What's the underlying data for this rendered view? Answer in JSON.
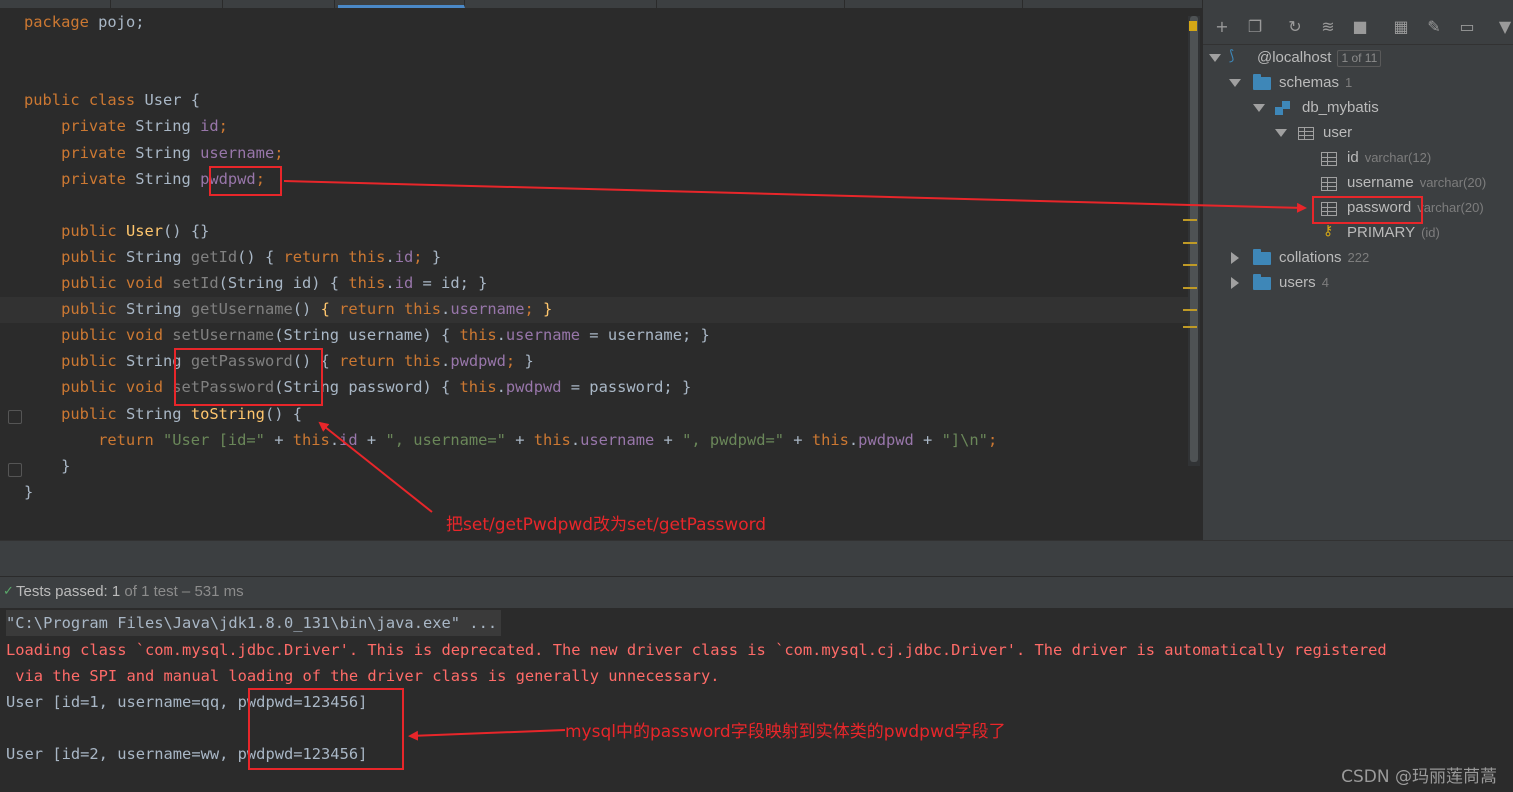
{
  "editor": {
    "lines": [
      {
        "parts": [
          {
            "t": "package ",
            "c": "kw"
          },
          {
            "t": "pojo;",
            "c": ""
          }
        ]
      },
      {
        "parts": []
      },
      {
        "parts": []
      },
      {
        "parts": [
          {
            "t": "public class ",
            "c": "kw"
          },
          {
            "t": "User {",
            "c": ""
          }
        ]
      },
      {
        "parts": [
          {
            "t": "    private ",
            "c": "kw"
          },
          {
            "t": "String ",
            "c": ""
          },
          {
            "t": "id",
            "c": "fld"
          },
          {
            "t": ";",
            "c": "kw"
          }
        ]
      },
      {
        "parts": [
          {
            "t": "    private ",
            "c": "kw"
          },
          {
            "t": "String ",
            "c": ""
          },
          {
            "t": "username",
            "c": "fld"
          },
          {
            "t": ";",
            "c": "kw"
          }
        ]
      },
      {
        "parts": [
          {
            "t": "    private ",
            "c": "kw"
          },
          {
            "t": "String ",
            "c": ""
          },
          {
            "t": "pwdpwd",
            "c": "fld"
          },
          {
            "t": ";",
            "c": "kw"
          }
        ]
      },
      {
        "parts": []
      },
      {
        "parts": [
          {
            "t": "    public ",
            "c": "kw"
          },
          {
            "t": "User",
            "c": "mth"
          },
          {
            "t": "() {}",
            "c": ""
          }
        ]
      },
      {
        "parts": [
          {
            "t": "    public ",
            "c": "kw"
          },
          {
            "t": "String ",
            "c": ""
          },
          {
            "t": "getId",
            "c": "dim"
          },
          {
            "t": "() { ",
            "c": ""
          },
          {
            "t": "return this",
            "c": "kw"
          },
          {
            "t": ".",
            "c": ""
          },
          {
            "t": "id",
            "c": "fld"
          },
          {
            "t": "; ",
            "c": "kw"
          },
          {
            "t": "}",
            "c": ""
          }
        ]
      },
      {
        "parts": [
          {
            "t": "    public void ",
            "c": "kw"
          },
          {
            "t": "setId",
            "c": "dim"
          },
          {
            "t": "(String id) { ",
            "c": ""
          },
          {
            "t": "this",
            "c": "kw"
          },
          {
            "t": ".",
            "c": ""
          },
          {
            "t": "id",
            "c": "fld"
          },
          {
            "t": " = id; }",
            "c": ""
          }
        ]
      },
      {
        "parts": [
          {
            "t": "    public ",
            "c": "kw"
          },
          {
            "t": "String ",
            "c": ""
          },
          {
            "t": "getUsername",
            "c": "dim"
          },
          {
            "t": "() ",
            "c": ""
          },
          {
            "t": "{",
            "c": "mth"
          },
          {
            "t": " return this",
            "c": "kw"
          },
          {
            "t": ".",
            "c": ""
          },
          {
            "t": "username",
            "c": "fld"
          },
          {
            "t": "; ",
            "c": "kw"
          },
          {
            "t": "}",
            "c": "mth"
          }
        ]
      },
      {
        "parts": [
          {
            "t": "    public void ",
            "c": "kw"
          },
          {
            "t": "setUsername",
            "c": "dim"
          },
          {
            "t": "(String username) { ",
            "c": ""
          },
          {
            "t": "this",
            "c": "kw"
          },
          {
            "t": ".",
            "c": ""
          },
          {
            "t": "username",
            "c": "fld"
          },
          {
            "t": " = username; }",
            "c": ""
          }
        ]
      },
      {
        "parts": [
          {
            "t": "    public ",
            "c": "kw"
          },
          {
            "t": "String ",
            "c": ""
          },
          {
            "t": "getPassword",
            "c": "dim"
          },
          {
            "t": "() { ",
            "c": ""
          },
          {
            "t": "return this",
            "c": "kw"
          },
          {
            "t": ".",
            "c": ""
          },
          {
            "t": "pwdpwd",
            "c": "fld"
          },
          {
            "t": "; ",
            "c": "kw"
          },
          {
            "t": "}",
            "c": ""
          }
        ]
      },
      {
        "parts": [
          {
            "t": "    public void ",
            "c": "kw"
          },
          {
            "t": "setPassword",
            "c": "dim"
          },
          {
            "t": "(String password) { ",
            "c": ""
          },
          {
            "t": "this",
            "c": "kw"
          },
          {
            "t": ".",
            "c": ""
          },
          {
            "t": "pwdpwd",
            "c": "fld"
          },
          {
            "t": " = password; }",
            "c": ""
          }
        ]
      },
      {
        "parts": [
          {
            "t": "    public ",
            "c": "kw"
          },
          {
            "t": "String ",
            "c": ""
          },
          {
            "t": "toString",
            "c": "mth"
          },
          {
            "t": "() {",
            "c": ""
          }
        ]
      },
      {
        "parts": [
          {
            "t": "        return ",
            "c": "kw"
          },
          {
            "t": "\"User [id=\"",
            "c": "str"
          },
          {
            "t": " + ",
            "c": ""
          },
          {
            "t": "this",
            "c": "kw"
          },
          {
            "t": ".",
            "c": ""
          },
          {
            "t": "id",
            "c": "fld"
          },
          {
            "t": " + ",
            "c": ""
          },
          {
            "t": "\", username=\"",
            "c": "str"
          },
          {
            "t": " + ",
            "c": ""
          },
          {
            "t": "this",
            "c": "kw"
          },
          {
            "t": ".",
            "c": ""
          },
          {
            "t": "username",
            "c": "fld"
          },
          {
            "t": " + ",
            "c": ""
          },
          {
            "t": "\", pwdpwd=\"",
            "c": "str"
          },
          {
            "t": " + ",
            "c": ""
          },
          {
            "t": "this",
            "c": "kw"
          },
          {
            "t": ".",
            "c": ""
          },
          {
            "t": "pwdpwd",
            "c": "fld"
          },
          {
            "t": " + ",
            "c": ""
          },
          {
            "t": "\"]\\n\"",
            "c": "str"
          },
          {
            "t": ";",
            "c": "kw"
          }
        ]
      },
      {
        "parts": [
          {
            "t": "    }",
            "c": ""
          }
        ]
      },
      {
        "parts": [
          {
            "t": "}",
            "c": ""
          }
        ]
      }
    ]
  },
  "db": {
    "host": "@localhost",
    "host_badge": "1 of 11",
    "schemas": "schemas",
    "schemas_count": "1",
    "db_name": "db_mybatis",
    "table": "user",
    "col_id": "id",
    "col_id_type": "varchar(12)",
    "col_username": "username",
    "col_username_type": "varchar(20)",
    "col_password": "password",
    "col_password_type": "varchar(20)",
    "primary": "PRIMARY",
    "primary_meta": "(id)",
    "collations": "collations",
    "collations_count": "222",
    "users": "users",
    "users_count": "4"
  },
  "status": {
    "passed_label": "Tests passed: ",
    "passed_count": "1",
    "passed_detail": " of 1 test – 531 ms"
  },
  "console": {
    "cmd": "\"C:\\Program Files\\Java\\jdk1.8.0_131\\bin\\java.exe\" ...",
    "warn1": "Loading class `com.mysql.jdbc.Driver'. This is deprecated. The new driver class is `com.mysql.cj.jdbc.Driver'. The driver is automatically registered",
    "warn2": " via the SPI and manual loading of the driver class is generally unnecessary.",
    "out1": "User [id=1, username=qq, pwdpwd=123456]",
    "out2": "User [id=2, username=ww, pwdpwd=123456]"
  },
  "annotations": {
    "note1": "把set/getPwdpwd改为set/getPassword",
    "note2": "mysql中的password字段映射到实体类的pwdpwd字段了"
  },
  "watermark": "CSDN @玛丽莲茼蒿",
  "colors": {
    "keyword": "#cc7832",
    "field": "#9876aa",
    "method": "#ffc66d",
    "string": "#6a8759",
    "error": "#ff6b68",
    "annotation": "#e8262a"
  }
}
